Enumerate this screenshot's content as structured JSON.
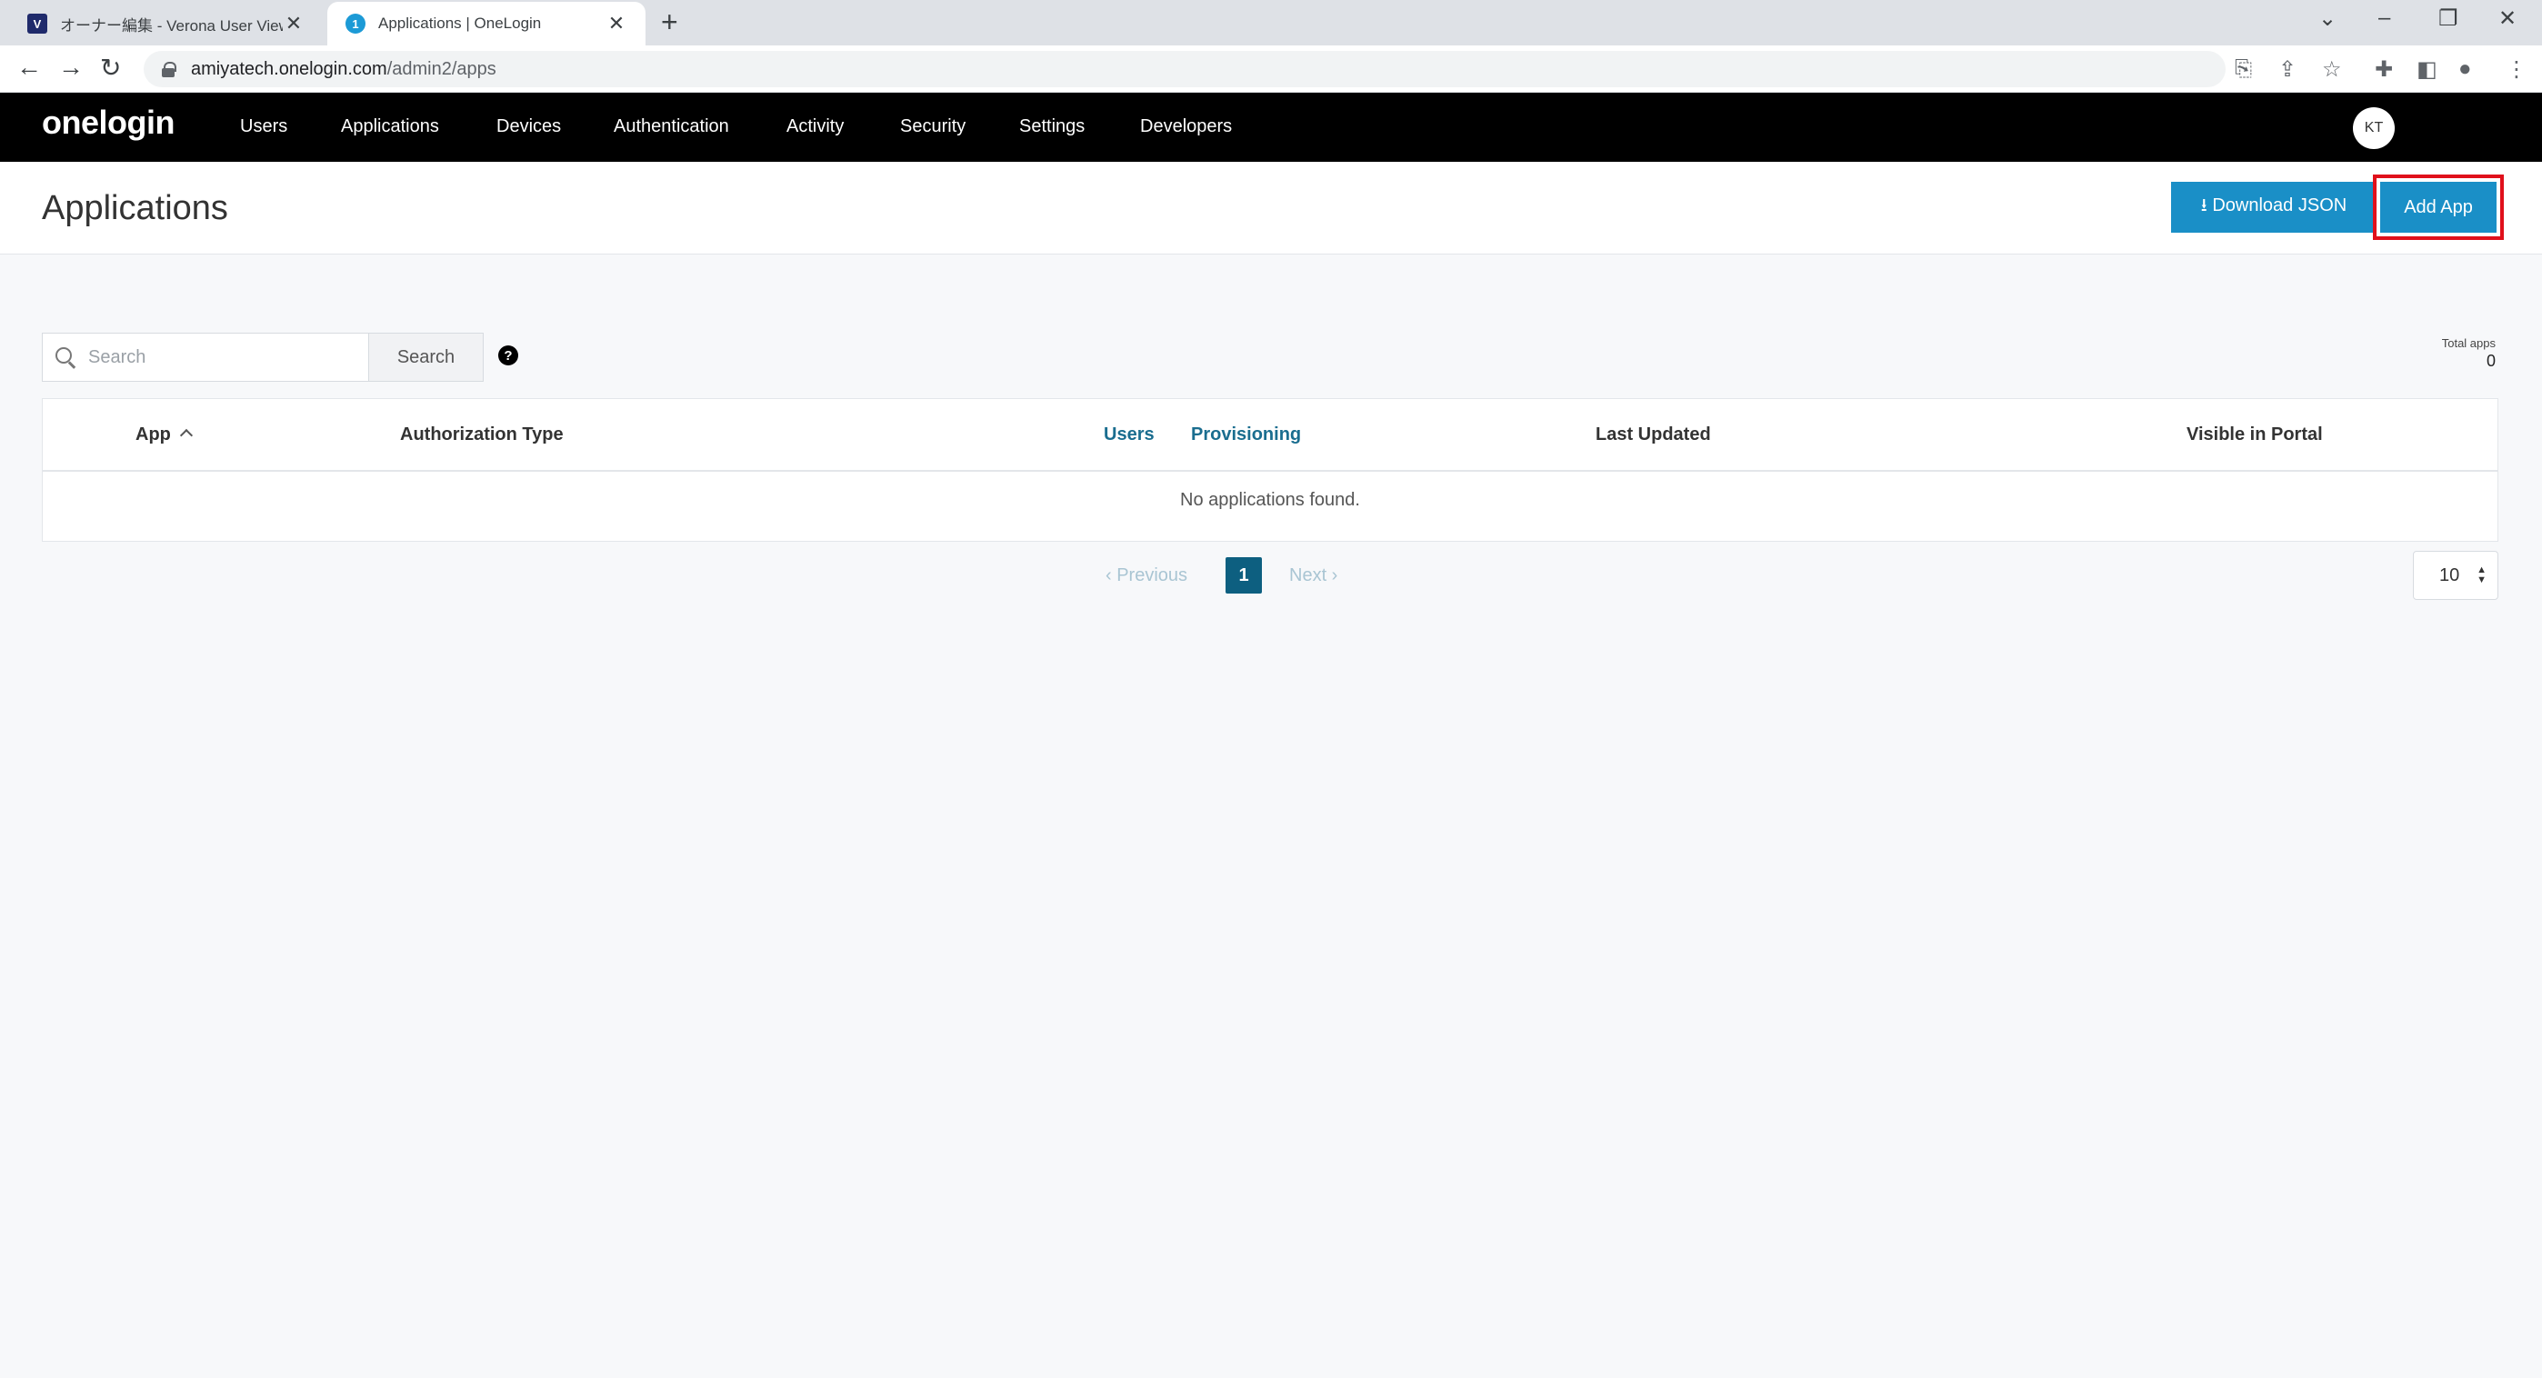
{
  "browser": {
    "tabs": [
      {
        "title": "オーナー編集 - Verona User View",
        "favicon": "V"
      },
      {
        "title": "Applications | OneLogin",
        "favicon": "1"
      }
    ],
    "address": {
      "host": "amiyatech.onelogin.com",
      "path": "/admin2/apps"
    }
  },
  "nav": {
    "logo": "onelogin",
    "items": [
      "Users",
      "Applications",
      "Devices",
      "Authentication",
      "Activity",
      "Security",
      "Settings",
      "Developers"
    ],
    "avatar": "KT"
  },
  "header": {
    "title": "Applications",
    "download_label": "⭳ Download JSON",
    "add_label": "Add App"
  },
  "search": {
    "placeholder": "Search",
    "button_label": "Search",
    "help": "?"
  },
  "totals": {
    "label": "Total apps",
    "value": "0"
  },
  "table": {
    "columns": [
      "App",
      "Authorization Type",
      "Users",
      "Provisioning",
      "Last Updated",
      "Visible in Portal"
    ],
    "empty_message": "No applications found."
  },
  "pagination": {
    "previous": "‹ Previous",
    "next": "Next ›",
    "current_page": "1",
    "page_size": "10"
  },
  "colors": {
    "accent": "#1a8fc7",
    "nav_bg": "#000000",
    "highlight": "#e0101b",
    "page_active": "#0d5f80"
  }
}
